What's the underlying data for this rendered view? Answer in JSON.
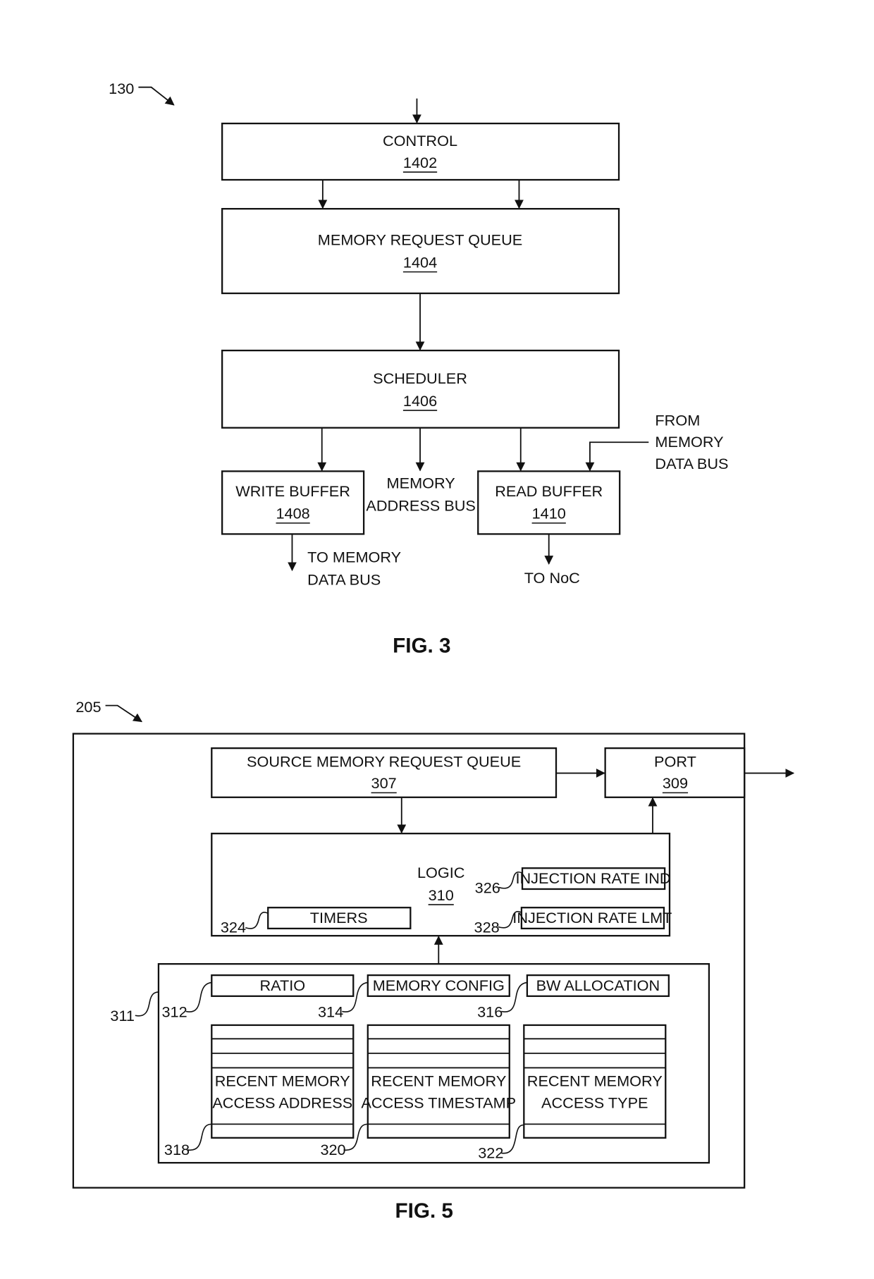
{
  "fig3": {
    "caption": "FIG. 3",
    "ref_label": "130",
    "blocks": {
      "control": {
        "name": "CONTROL",
        "ref": "1402"
      },
      "memory_request_queue": {
        "name": "MEMORY REQUEST QUEUE",
        "ref": "1404"
      },
      "scheduler": {
        "name": "SCHEDULER",
        "ref": "1406"
      },
      "write_buffer": {
        "name": "WRITE BUFFER",
        "ref": "1408"
      },
      "read_buffer": {
        "name": "READ BUFFER",
        "ref": "1410"
      }
    },
    "annotations": {
      "memory_address_bus": [
        "MEMORY",
        "ADDRESS BUS"
      ],
      "from_memory_data_bus": [
        "FROM",
        "MEMORY",
        "DATA BUS"
      ],
      "to_memory_data_bus": [
        "TO MEMORY",
        "DATA BUS"
      ],
      "to_noc": "TO NoC"
    }
  },
  "fig5": {
    "caption": "FIG. 5",
    "ref_label": "205",
    "blocks": {
      "source_memory_request_queue": {
        "name": "SOURCE MEMORY REQUEST QUEUE",
        "ref": "307"
      },
      "port": {
        "name": "PORT",
        "ref": "309"
      },
      "logic": {
        "name": "LOGIC",
        "ref": "310"
      },
      "timers": {
        "name": "TIMERS",
        "ref": "324"
      },
      "injection_rate_ind": {
        "name": "INJECTION RATE IND",
        "ref": "326"
      },
      "injection_rate_lmt": {
        "name": "INJECTION RATE LMT",
        "ref": "328"
      },
      "storage": {
        "ref": "311"
      },
      "ratio": {
        "name": "RATIO",
        "ref": "312"
      },
      "memory_config": {
        "name": "MEMORY CONFIG",
        "ref": "314"
      },
      "bw_allocation": {
        "name": "BW ALLOCATION",
        "ref": "316"
      },
      "recent_access_address": {
        "line1": "RECENT MEMORY",
        "line2": "ACCESS ADDRESS",
        "ref": "318"
      },
      "recent_access_timestamp": {
        "line1": "RECENT MEMORY",
        "line2": "ACCESS TIMESTAMP",
        "ref": "320"
      },
      "recent_access_type": {
        "line1": "RECENT MEMORY",
        "line2": "ACCESS TYPE",
        "ref": "322"
      }
    }
  }
}
